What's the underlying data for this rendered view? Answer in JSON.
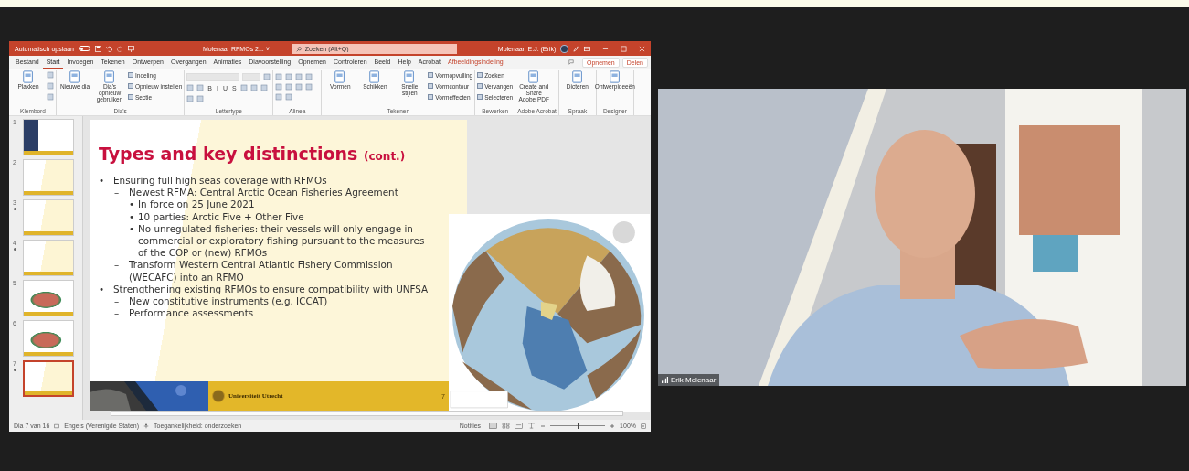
{
  "presentation": {
    "title_bar": {
      "autosave_label": "Automatisch opslaan",
      "autosave_on": false,
      "file_name": "Molenaar RFMOs 2... ˅",
      "search_placeholder": "Zoeken (Alt+Q)",
      "user": "Molenaar, E.J. (Erik)"
    },
    "tabs": [
      {
        "label": "Bestand",
        "selected": false,
        "kind": "tab"
      },
      {
        "label": "Start",
        "selected": true,
        "kind": "tab"
      },
      {
        "label": "Invoegen",
        "selected": false,
        "kind": "tab"
      },
      {
        "label": "Tekenen",
        "selected": false,
        "kind": "tab"
      },
      {
        "label": "Ontwerpen",
        "selected": false,
        "kind": "tab"
      },
      {
        "label": "Overgangen",
        "selected": false,
        "kind": "tab"
      },
      {
        "label": "Animaties",
        "selected": false,
        "kind": "tab"
      },
      {
        "label": "Diavoorstelling",
        "selected": false,
        "kind": "tab"
      },
      {
        "label": "Opnemen",
        "selected": false,
        "kind": "tab"
      },
      {
        "label": "Controleren",
        "selected": false,
        "kind": "tab"
      },
      {
        "label": "Beeld",
        "selected": false,
        "kind": "tab"
      },
      {
        "label": "Help",
        "selected": false,
        "kind": "tab"
      },
      {
        "label": "Acrobat",
        "selected": false,
        "kind": "tab"
      },
      {
        "label": "Afbeeldingsindeling",
        "selected": false,
        "kind": "context"
      }
    ],
    "record_button": "Opnemen",
    "share_button": "Delen",
    "ribbon_groups": [
      {
        "label": "Klembord",
        "kind": "columns",
        "items": [
          {
            "kind": "large",
            "label": "Plakken"
          },
          {
            "kind": "icon"
          },
          {
            "kind": "icon"
          },
          {
            "kind": "icon"
          }
        ]
      },
      {
        "label": "Dia's",
        "kind": "columns",
        "items": [
          {
            "kind": "large",
            "label": "Nieuwe dia"
          },
          {
            "kind": "large",
            "label": "Dia's opnieuw gebruiken"
          },
          {
            "kind": "small",
            "label": "Indeling"
          },
          {
            "kind": "small",
            "label": "Opnieuw instellen"
          },
          {
            "kind": "small",
            "label": "Sectie"
          }
        ]
      },
      {
        "label": "Lettertype",
        "kind": "rows",
        "items": [
          {
            "kind": "font-field"
          },
          {
            "kind": "size-field"
          },
          {
            "kind": "icon"
          },
          {
            "kind": "icon"
          },
          {
            "kind": "icon"
          },
          {
            "kind": "glyph",
            "label": "B"
          },
          {
            "kind": "glyph",
            "label": "I"
          },
          {
            "kind": "glyph",
            "label": "U"
          },
          {
            "kind": "glyph",
            "label": "S"
          },
          {
            "kind": "icon"
          },
          {
            "kind": "icon"
          },
          {
            "kind": "icon"
          },
          {
            "kind": "icon"
          },
          {
            "kind": "icon"
          }
        ]
      },
      {
        "label": "Alinea",
        "kind": "rows",
        "items": [
          {
            "kind": "icon"
          },
          {
            "kind": "icon"
          },
          {
            "kind": "icon"
          },
          {
            "kind": "icon"
          },
          {
            "kind": "icon"
          },
          {
            "kind": "icon"
          },
          {
            "kind": "icon"
          },
          {
            "kind": "icon"
          },
          {
            "kind": "icon"
          },
          {
            "kind": "icon"
          }
        ]
      },
      {
        "label": "Tekenen",
        "kind": "columns",
        "items": [
          {
            "kind": "large",
            "label": "Vormen"
          },
          {
            "kind": "large",
            "label": "Schikken"
          },
          {
            "kind": "large",
            "label": "Snelle stijlen"
          },
          {
            "kind": "small",
            "label": "Vormopvulling"
          },
          {
            "kind": "small",
            "label": "Vormcontour"
          },
          {
            "kind": "small",
            "label": "Vormeffecten"
          }
        ]
      },
      {
        "label": "Bewerken",
        "kind": "columns",
        "items": [
          {
            "kind": "small",
            "label": "Zoeken"
          },
          {
            "kind": "small",
            "label": "Vervangen"
          },
          {
            "kind": "small",
            "label": "Selecteren"
          }
        ]
      },
      {
        "label": "Adobe Acrobat",
        "kind": "columns",
        "items": [
          {
            "kind": "large",
            "label": "Create and Share Adobe PDF"
          }
        ]
      },
      {
        "label": "Spraak",
        "kind": "columns",
        "items": [
          {
            "kind": "large",
            "label": "Dicteren"
          }
        ]
      },
      {
        "label": "Designer",
        "kind": "columns",
        "items": [
          {
            "kind": "large",
            "label": "Ontwerpideeën"
          }
        ]
      }
    ],
    "thumbnails": [
      {
        "number": "1",
        "selected": false,
        "animated": false
      },
      {
        "number": "2",
        "kind": "text",
        "selected": false,
        "animated": false
      },
      {
        "number": "3",
        "kind": "text",
        "selected": false,
        "animated": true
      },
      {
        "number": "4",
        "kind": "text",
        "selected": false,
        "animated": true
      },
      {
        "number": "5",
        "kind": "map",
        "selected": false,
        "animated": false
      },
      {
        "number": "6",
        "kind": "map",
        "selected": false,
        "animated": false
      },
      {
        "number": "7",
        "kind": "text",
        "selected": true,
        "animated": true
      }
    ],
    "slide": {
      "title": "Types and key distinctions",
      "title_suffix": "(cont.)",
      "bullets": [
        {
          "marker": "•",
          "text": "Ensuring full high seas coverage with RFMOs",
          "children": [
            {
              "marker": "–",
              "text": "Newest RFMA: Central Arctic Ocean Fisheries Agreement",
              "children": [
                {
                  "marker": "•",
                  "text": "In force on 25 June 2021"
                },
                {
                  "marker": "•",
                  "text": "10 parties: Arctic Five + Other Five"
                },
                {
                  "marker": "•",
                  "text": "No unregulated fisheries: their vessels will only engage in commercial or exploratory fishing pursuant to the measures of the COP or (new) RFMOs"
                }
              ]
            },
            {
              "marker": "–",
              "text": "Transform Western Central Atlantic Fishery Commission (WECAFC) into an RFMO"
            }
          ]
        },
        {
          "marker": "•",
          "text": "Strengthening existing RFMOs to ensure compatibility with UNFSA",
          "children": [
            {
              "marker": "–",
              "text": "New constitutive instruments (e.g. ICCAT)"
            },
            {
              "marker": "–",
              "text": "Performance assessments"
            }
          ]
        }
      ],
      "footer": "Universiteit Utrecht",
      "page_number": "7"
    },
    "status_bar": {
      "slide_counter": "Dia 7 van 16",
      "language": "Engels (Verenigde Staten)",
      "accessibility": "Toegankelijkheid: onderzoeken",
      "notes": "Notities",
      "zoom": "100%",
      "zoom_slider": {
        "level": 0.5
      }
    }
  },
  "video": {
    "name": "Erik Molenaar"
  }
}
